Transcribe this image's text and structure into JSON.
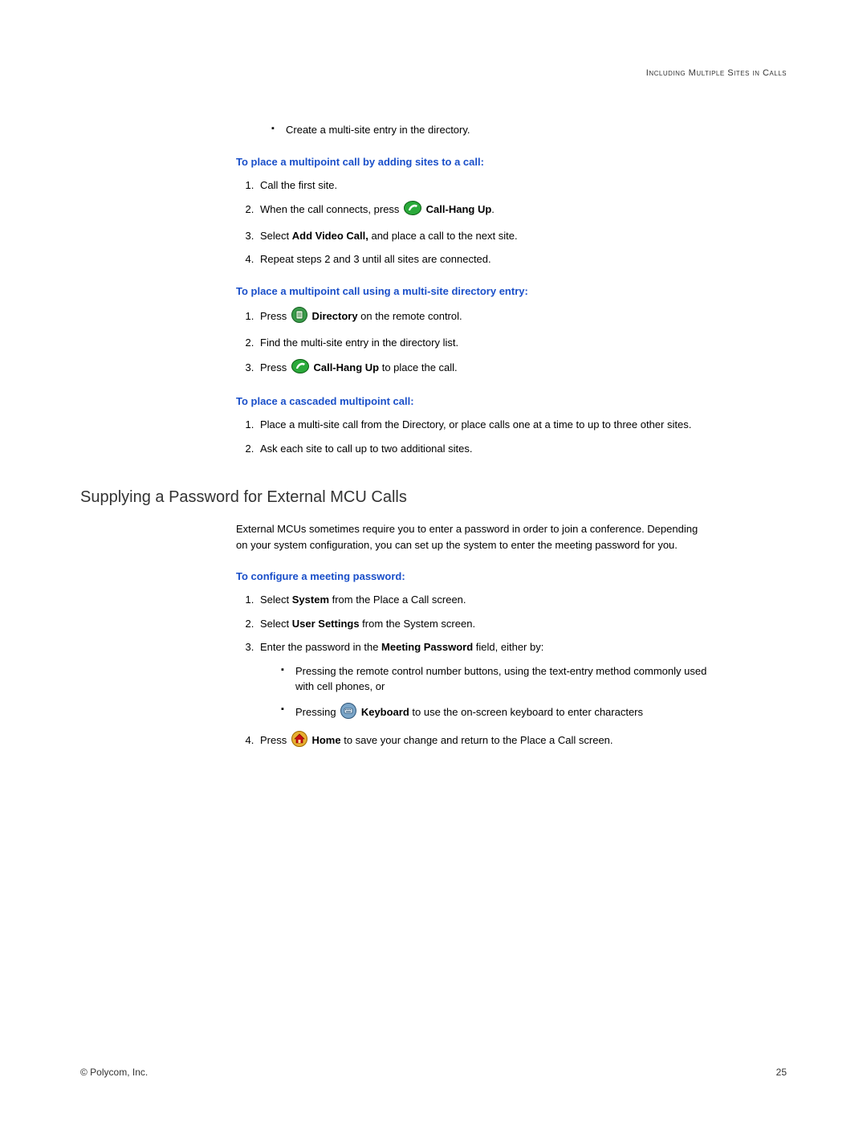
{
  "header": {
    "running_title": "Including Multiple Sites in Calls"
  },
  "intro_bullets": [
    "Create a multi-site entry in the directory."
  ],
  "section1": {
    "heading": "To place a multipoint call by adding sites to a call:",
    "steps": {
      "s1": "Call the first site.",
      "s2_pre": "When the call connects, press ",
      "s2_bold": "Call-Hang Up",
      "s2_post": ".",
      "s3_pre": "Select ",
      "s3_bold": "Add Video Call,",
      "s3_post": " and place a call to the next site.",
      "s4": "Repeat steps 2 and 3 until all sites are connected."
    }
  },
  "section2": {
    "heading": "To place a multipoint call using a multi-site directory entry:",
    "steps": {
      "s1_pre": "Press ",
      "s1_bold": "Directory",
      "s1_post": " on the remote control.",
      "s2": "Find the multi-site entry in the directory list.",
      "s3_pre": "Press ",
      "s3_bold": "Call-Hang Up",
      "s3_post": " to place the call."
    }
  },
  "section3": {
    "heading": "To place a cascaded multipoint call:",
    "steps": {
      "s1": "Place a multi-site call from the Directory, or place calls one at a time to up to three other sites.",
      "s2": "Ask each site to call up to two additional sites."
    }
  },
  "section4": {
    "title": "Supplying a Password for External MCU Calls",
    "para": "External MCUs sometimes require you to enter a password in order to join a conference. Depending on your system configuration, you can set up the system to enter the meeting password for you.",
    "sub_heading": "To configure a meeting password:",
    "steps": {
      "s1_pre": "Select ",
      "s1_bold": "System",
      "s1_post": " from the Place a Call screen.",
      "s2_pre": "Select ",
      "s2_bold": "User Settings",
      "s2_post": " from the System screen.",
      "s3_pre": "Enter the password in the ",
      "s3_bold": "Meeting Password",
      "s3_post": " field, either by:",
      "s3_sub1": "Pressing the remote control number buttons, using the text-entry method commonly used with cell phones, or",
      "s3_sub2_pre": "Pressing ",
      "s3_sub2_bold": "Keyboard",
      "s3_sub2_post": " to use the on-screen keyboard to enter characters",
      "s4_pre": "Press ",
      "s4_bold": "Home",
      "s4_post": " to save your change and return to the Place a Call screen."
    }
  },
  "footer": {
    "copyright": "© Polycom, Inc.",
    "page": "25"
  },
  "icons": {
    "call": "call-hangup-icon",
    "directory": "directory-icon",
    "keyboard": "keyboard-icon",
    "home": "home-icon"
  }
}
